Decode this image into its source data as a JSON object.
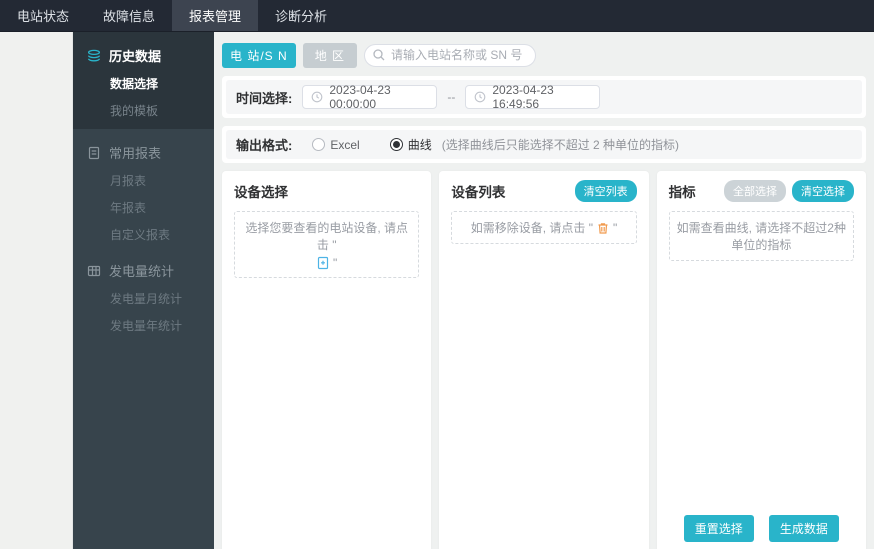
{
  "navbar": {
    "tabs": [
      {
        "label": "电站状态",
        "active": false
      },
      {
        "label": "故障信息",
        "active": false
      },
      {
        "label": "报表管理",
        "active": true
      },
      {
        "label": "诊断分析",
        "active": false
      }
    ]
  },
  "sidebar": {
    "groups": [
      {
        "label": "历史数据",
        "icon": "layers-icon",
        "active": true,
        "items": [
          {
            "label": "数据选择",
            "active": true
          },
          {
            "label": "我的模板",
            "active": false
          }
        ]
      },
      {
        "label": "常用报表",
        "icon": "report-icon",
        "active": false,
        "items": [
          {
            "label": "月报表"
          },
          {
            "label": "年报表"
          },
          {
            "label": "自定义报表"
          }
        ]
      },
      {
        "label": "发电量统计",
        "icon": "table-icon",
        "active": false,
        "items": [
          {
            "label": "发电量月统计"
          },
          {
            "label": "发电量年统计"
          }
        ]
      }
    ]
  },
  "filter_bar": {
    "station_sn_button": "电 站/S N",
    "region_button": "地 区",
    "search_placeholder": "请输入电站名称或 SN 号",
    "search_icon": "search-icon"
  },
  "time_row": {
    "label": "时间选择:",
    "start_value": "2023-04-23 00:00:00",
    "separator": "--",
    "end_value": "2023-04-23 16:49:56",
    "clock_icon": "clock-icon"
  },
  "format_row": {
    "label": "输出格式:",
    "options": [
      {
        "label": "Excel",
        "selected": false
      },
      {
        "label": "曲线",
        "selected": true
      }
    ],
    "selected": "曲线",
    "note": "(选择曲线后只能选择不超过 2 种单位的指标)"
  },
  "panels": {
    "device_select": {
      "title": "设备选择",
      "hint_prefix": "选择您要查看的电站设备, 请点击 \"",
      "hint_icon": "add-device-file-icon",
      "hint_suffix": "\""
    },
    "device_list": {
      "title": "设备列表",
      "clear_button": "清空列表",
      "hint_prefix": "如需移除设备, 请点击 \"",
      "hint_icon": "trash-icon",
      "hint_suffix": "\""
    },
    "indicators": {
      "title": "指标",
      "select_all_button": "全部选择",
      "clear_button": "清空选择",
      "hint": "如需查看曲线, 请选择不超过2种单位的指标"
    }
  },
  "actions": {
    "reset_button": "重置选择",
    "generate_button": "生成数据"
  },
  "colors": {
    "accent": "#29b4ca",
    "navbar_bg": "#232934",
    "navbar_active_bg": "#3d4450",
    "sidebar_bg": "#37444c",
    "sidebar_active_group_bg": "#2b353c",
    "page_bg": "#eff1f0",
    "disabled_pill": "#ccd3d7",
    "trash_icon_color": "#f19a4d",
    "file_icon_color": "#4db3e6"
  }
}
